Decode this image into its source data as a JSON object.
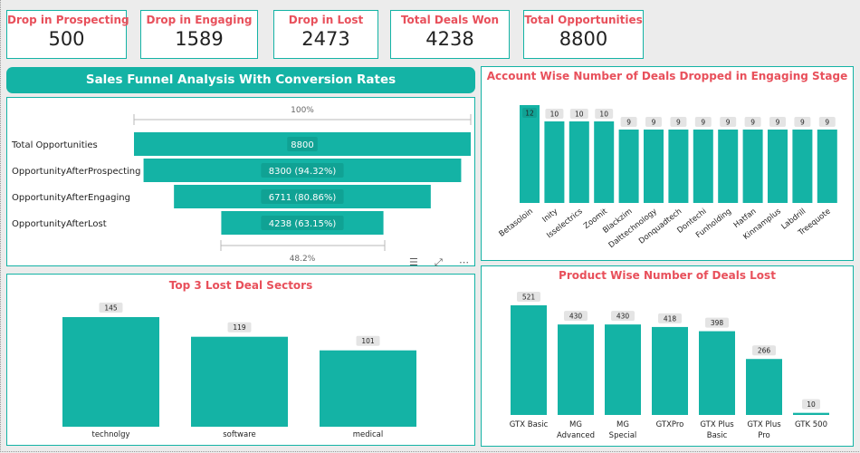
{
  "kpis": [
    {
      "label": "Drop in Prospecting",
      "value": "500"
    },
    {
      "label": "Drop in Engaging",
      "value": "1589"
    },
    {
      "label": "Drop in Lost",
      "value": "2473"
    },
    {
      "label": "Total Deals Won",
      "value": "4238"
    },
    {
      "label": "Total Opportunities",
      "value": "8800"
    }
  ],
  "funnel": {
    "title": "Sales Funnel Analysis With Conversion Rates",
    "top_pct": "100%",
    "bottom_pct": "48.2%",
    "stages": [
      {
        "label": "Total Opportunities",
        "value": 8800,
        "text": "8800"
      },
      {
        "label": "OpportunityAfterProspecting",
        "value": 8300,
        "text": "8300 (94.32%)"
      },
      {
        "label": "OpportunityAfterEngaging",
        "value": 6711,
        "text": "6711 (80.86%)"
      },
      {
        "label": "OpportunityAfterLost",
        "value": 4238,
        "text": "4238 (63.15%)"
      }
    ],
    "toolbar_icons": [
      "filter-icon",
      "focus-mode-icon",
      "more-options-icon"
    ]
  },
  "colors": {
    "bar": "#14b3a5",
    "accent_red": "#e8505b"
  },
  "chart_data": [
    {
      "type": "bar",
      "title": "Account Wise Number of Deals Dropped in Engaging Stage",
      "categories": [
        "Betasoloin",
        "Inity",
        "Isselectrics",
        "Zoomit",
        "Blackzim",
        "Dalttechnology",
        "Donquadtech",
        "Dontechi",
        "Funholding",
        "Hatfan",
        "Kinnamplus",
        "Labdrill",
        "Treequote"
      ],
      "values": [
        12,
        10,
        10,
        10,
        9,
        9,
        9,
        9,
        9,
        9,
        9,
        9,
        9
      ],
      "ylim": [
        0,
        12
      ]
    },
    {
      "type": "bar",
      "title": "Top 3 Lost Deal Sectors",
      "categories": [
        "technolgy",
        "software",
        "medical"
      ],
      "values": [
        145,
        119,
        101
      ],
      "ylim": [
        0,
        145
      ]
    },
    {
      "type": "bar",
      "title": "Product Wise Number of Deals Lost",
      "categories": [
        "GTX Basic",
        "MG Advanced",
        "MG Special",
        "GTXPro",
        "GTX Plus Basic",
        "GTX Plus Pro",
        "GTK 500"
      ],
      "values": [
        521,
        430,
        430,
        418,
        398,
        266,
        10
      ],
      "ylim": [
        0,
        521
      ]
    }
  ]
}
